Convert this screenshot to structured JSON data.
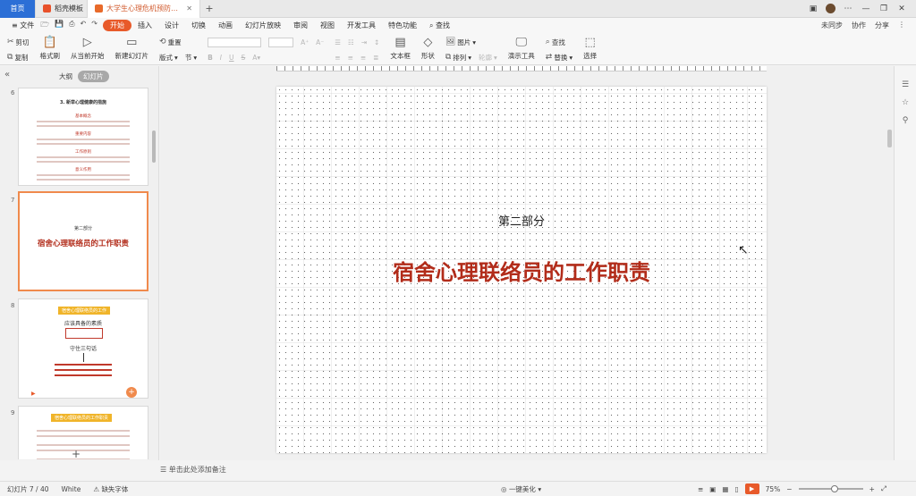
{
  "titlebar": {
    "tabs": [
      {
        "label": "首页"
      },
      {
        "label": "稻壳模板"
      },
      {
        "label": "大学生心理危机预防与干预.pptx"
      }
    ],
    "new_tab": "+"
  },
  "menubar": {
    "file_label": "≡ 文件",
    "items": [
      "开始",
      "插入",
      "设计",
      "切换",
      "动画",
      "幻灯片放映",
      "审阅",
      "视图",
      "开发工具",
      "特色功能"
    ],
    "search": "查找",
    "right": [
      "未同步",
      "协作",
      "分享"
    ]
  },
  "ribbon": {
    "paste": "粘贴",
    "cut": "剪切",
    "copy": "复制",
    "format_painter": "格式刷",
    "from_current": "从当前开始",
    "new_slide": "新建幻灯片",
    "layout": "版式",
    "section": "节",
    "reset": "重置",
    "textbox": "文本框",
    "shape": "形状",
    "arrange": "排列",
    "picture": "图片",
    "outline": "轮廓",
    "present_tools": "演示工具",
    "find": "查找",
    "replace": "替换",
    "select": "选择"
  },
  "leftpanel": {
    "tab_outline": "大纲",
    "tab_slides": "幻灯片",
    "slides": [
      {
        "num": "6",
        "title": "3. 新举心理健康的措施",
        "lines": [
          "基本概念",
          "重要内容",
          "工作原则",
          "意义作用"
        ]
      },
      {
        "num": "7",
        "label": "第二部分",
        "title": "宿舍心理联络员的工作职责"
      },
      {
        "num": "8",
        "header": "宿舍心理联络员的工作",
        "items": [
          "应该具备的素质",
          "守住三句话"
        ]
      },
      {
        "num": "9",
        "header": "宿舍心理联络员的工作职责"
      }
    ],
    "add": "+"
  },
  "slide": {
    "subtitle": "第二部分",
    "title": "宿舍心理联络员的工作职责",
    "notes_placeholder": "单击此处添加备注"
  },
  "statusbar": {
    "slide_info": "幻灯片 7 / 40",
    "theme": "White",
    "font_missing": "缺失字体",
    "beautify": "一键美化",
    "zoom": "75%"
  },
  "colors": {
    "accent": "#e85a2a",
    "title_red": "#b22c1a",
    "home_blue": "#2c6fd6"
  }
}
